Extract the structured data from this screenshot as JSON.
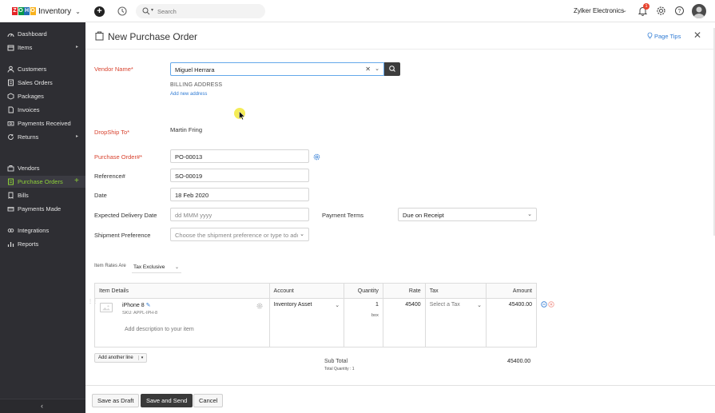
{
  "topbar": {
    "logo_letters": [
      "Z",
      "O",
      "H",
      "O"
    ],
    "logo_colors": [
      "#e42527",
      "#089949",
      "#226db4",
      "#f9b21d"
    ],
    "brand": "Inventory",
    "search_placeholder": "Search",
    "org_name": "Zylker Electronics",
    "notification_count": "1",
    "icons": [
      "plus-circle-icon",
      "history-icon",
      "search-icon",
      "bell-icon",
      "gear-icon",
      "help-icon",
      "avatar"
    ]
  },
  "sidebar": {
    "items": [
      {
        "label": "Dashboard",
        "icon": "dashboard-icon"
      },
      {
        "label": "Items",
        "icon": "items-icon",
        "arrow": "▸"
      },
      {
        "label": "Customers",
        "icon": "customers-icon"
      },
      {
        "label": "Sales Orders",
        "icon": "sales-orders-icon"
      },
      {
        "label": "Packages",
        "icon": "packages-icon"
      },
      {
        "label": "Invoices",
        "icon": "invoices-icon"
      },
      {
        "label": "Payments Received",
        "icon": "payments-received-icon"
      },
      {
        "label": "Returns",
        "icon": "returns-icon",
        "arrow": "▸"
      },
      {
        "label": "Vendors",
        "icon": "vendors-icon"
      },
      {
        "label": "Purchase Orders",
        "icon": "purchase-orders-icon",
        "plus": "+"
      },
      {
        "label": "Bills",
        "icon": "bills-icon"
      },
      {
        "label": "Payments Made",
        "icon": "payments-made-icon"
      },
      {
        "label": "Integrations",
        "icon": "integrations-icon"
      },
      {
        "label": "Reports",
        "icon": "reports-icon"
      }
    ],
    "collapse_glyph": "‹",
    "accent": "#8ed138"
  },
  "page": {
    "title": "New Purchase Order",
    "page_tips": "Page Tips",
    "close_glyph": "✕"
  },
  "form": {
    "vendor_label": "Vendor Name*",
    "vendor_value": "Miguel Herrara",
    "billing_address": "BILLING ADDRESS",
    "add_new_address": "Add new address",
    "dropship_label": "DropShip To*",
    "dropship_value": "Martin Fring",
    "po_label": "Purchase Order#*",
    "po_value": "PO-00013",
    "reference_label": "Reference#",
    "reference_value": "SO-00019",
    "date_label": "Date",
    "date_value": "18 Feb 2020",
    "delivery_label": "Expected Delivery Date",
    "delivery_placeholder": "dd MMM yyyy",
    "payment_terms_label": "Payment Terms",
    "payment_terms_value": "Due on Receipt",
    "shipment_label": "Shipment Preference",
    "shipment_placeholder": "Choose the shipment preference or type to add"
  },
  "items": {
    "rates_label": "Item Rates Are",
    "rates_value": "Tax Exclusive",
    "columns": [
      "Item Details",
      "Account",
      "Quantity",
      "Rate",
      "Tax",
      "Amount"
    ],
    "row": {
      "name": "iPhone 8",
      "sku": "SKU: APPL-IPH-8",
      "description_placeholder": "Add description to your item",
      "account": "Inventory Asset",
      "quantity": "1",
      "unit": "box",
      "rate": "45400",
      "tax_placeholder": "Select a Tax",
      "amount": "45400.00"
    },
    "add_line": "Add another line",
    "subtotal_label": "Sub Total",
    "subtotal_value": "45400.00",
    "total_quantity": "Total Quantity : 1"
  },
  "footer": {
    "save_draft": "Save as Draft",
    "save_send": "Save and Send",
    "cancel": "Cancel"
  }
}
